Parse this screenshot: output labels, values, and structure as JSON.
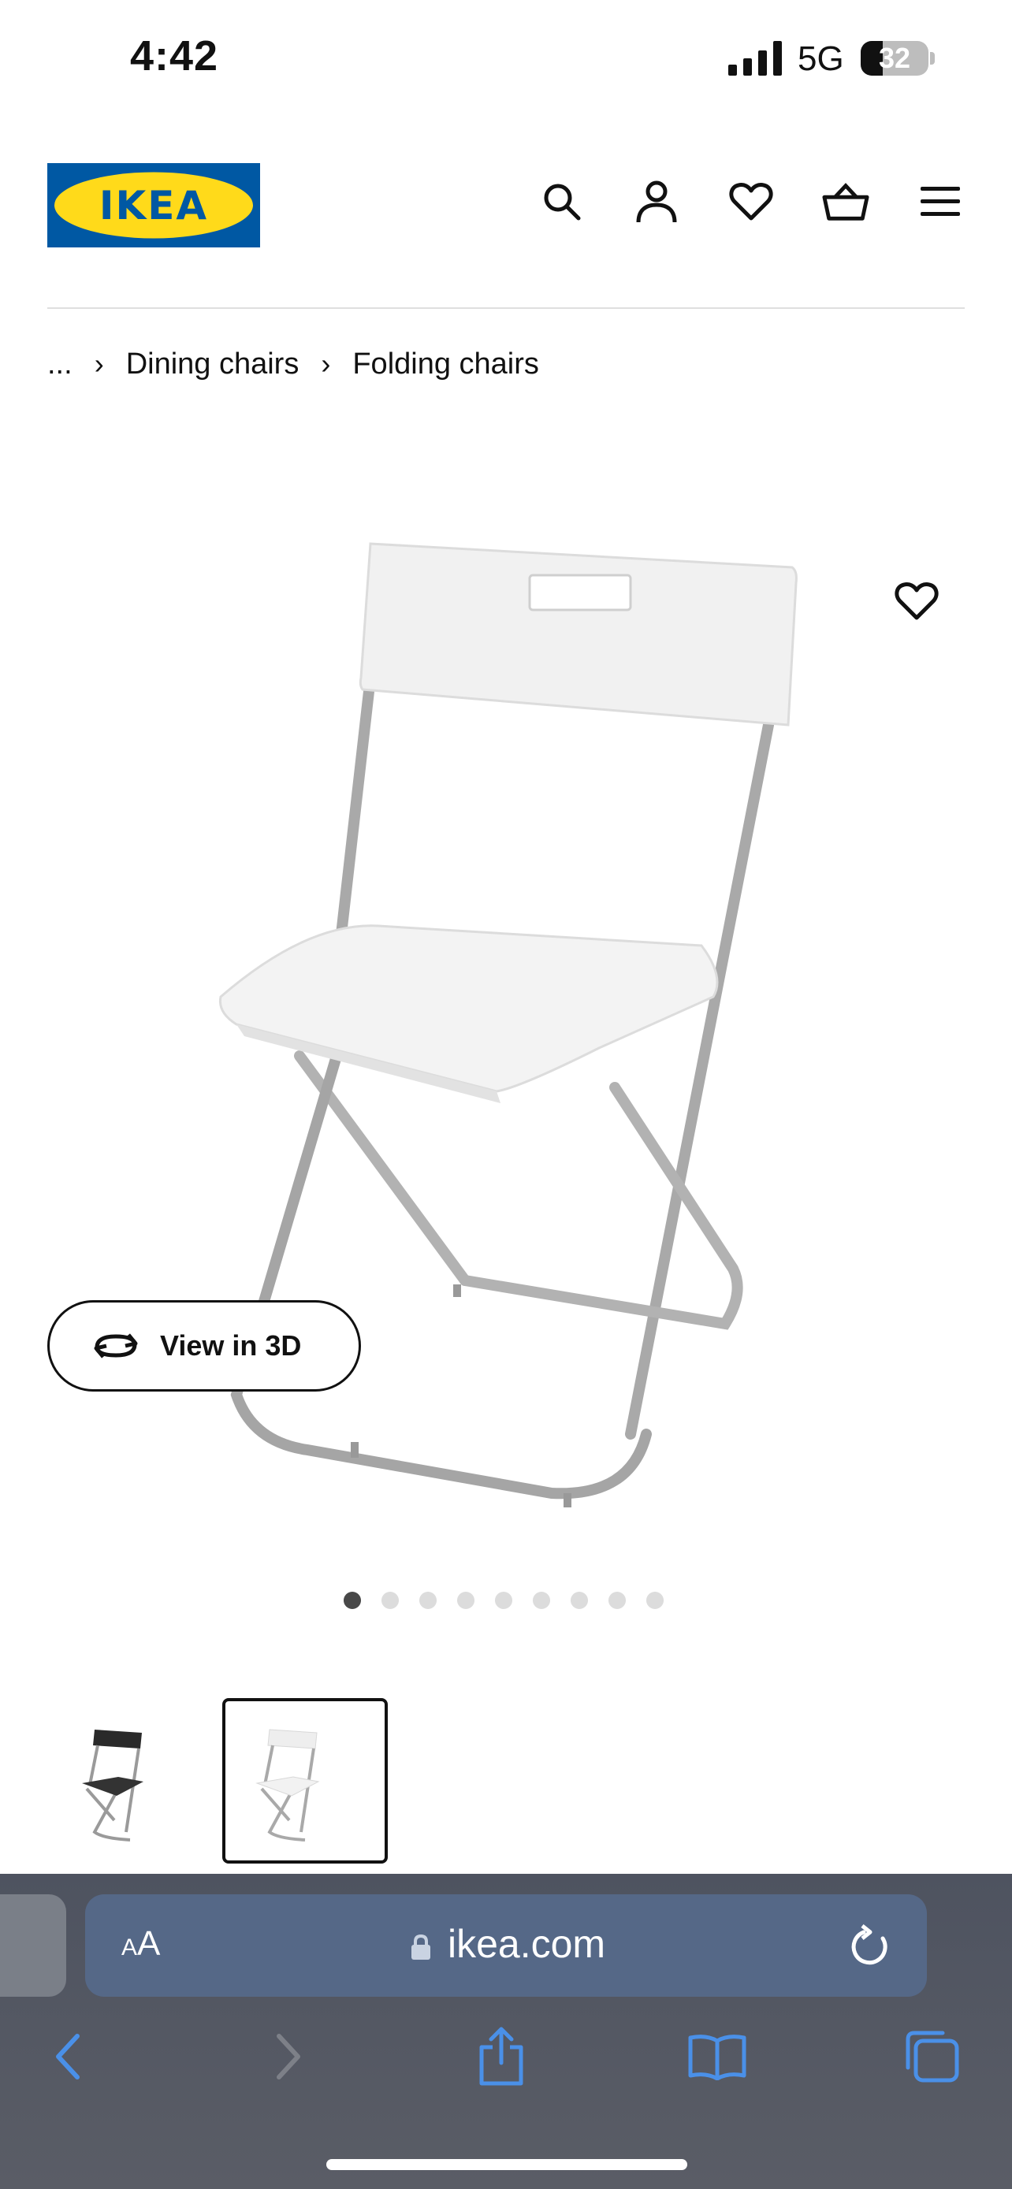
{
  "status_bar": {
    "time": "4:42",
    "network": "5G",
    "battery_percent": 32,
    "battery_label": "32"
  },
  "header": {
    "logo_text": "IKEA",
    "icons": [
      "search-icon",
      "account-icon",
      "heart-icon",
      "cart-basket-icon",
      "menu-icon"
    ]
  },
  "breadcrumb": {
    "ellipsis": "...",
    "items": [
      "Dining chairs",
      "Folding chairs"
    ]
  },
  "product": {
    "view3d_label": "View in 3D",
    "gallery_count": 9,
    "gallery_active": 1
  },
  "thumbnails": [
    {
      "variant": "black",
      "selected": false
    },
    {
      "variant": "white",
      "selected": true
    }
  ],
  "browser": {
    "text_size_label": "AA",
    "domain": "ikea.com"
  },
  "colors": {
    "ikea_blue": "#0058a3",
    "ikea_yellow": "#ffda1a",
    "safari_bar": "#556887"
  }
}
